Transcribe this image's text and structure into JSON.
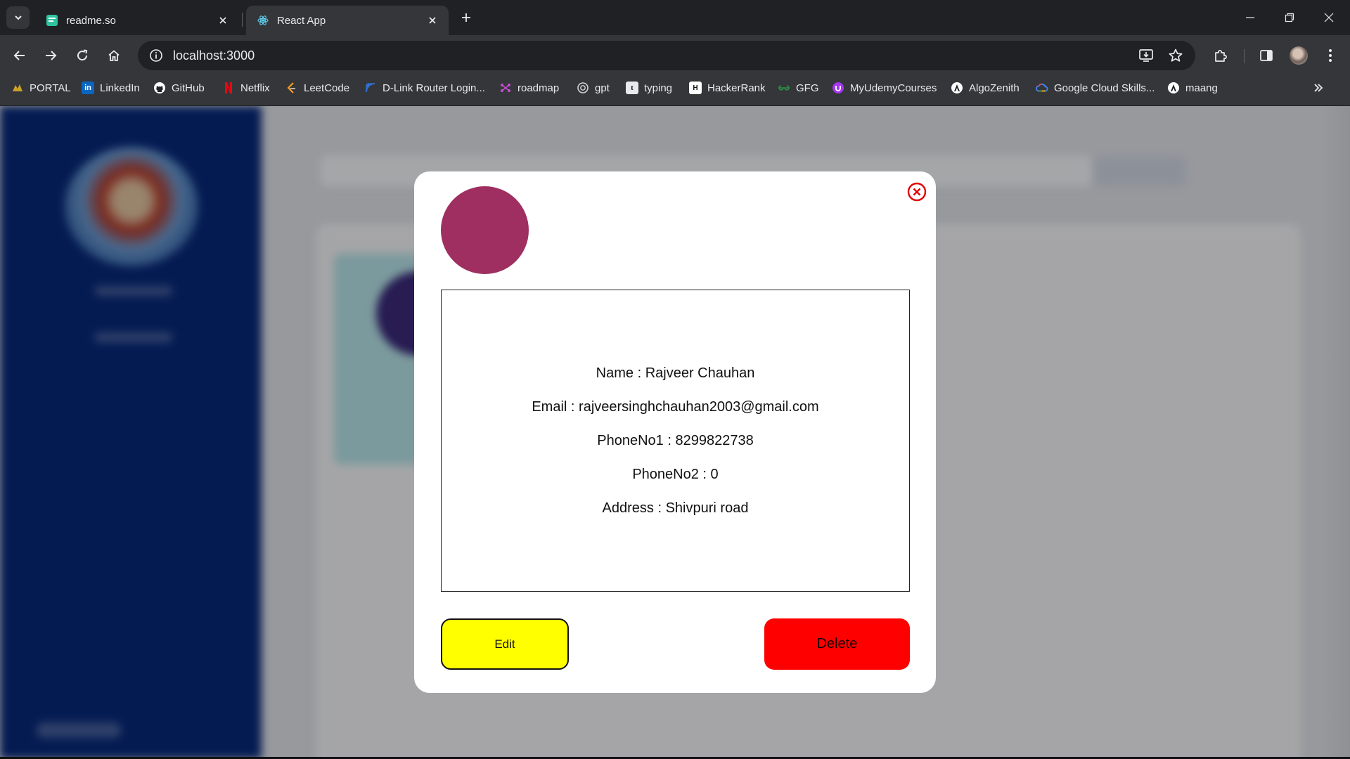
{
  "browser": {
    "tabs": [
      {
        "title": "readme.so",
        "favicon": "readme-icon",
        "active": false
      },
      {
        "title": "React App",
        "favicon": "react-icon",
        "active": true
      }
    ],
    "address": "localhost:3000",
    "bookmarks": [
      {
        "label": "PORTAL",
        "icon": "portal-icon",
        "color": "#c9a227"
      },
      {
        "label": "LinkedIn",
        "icon": "linkedin-icon",
        "color": "#0a66c2"
      },
      {
        "label": "GitHub",
        "icon": "github-icon",
        "color": "#ffffff"
      },
      {
        "label": "Netflix",
        "icon": "netflix-icon",
        "color": "#e50914"
      },
      {
        "label": "LeetCode",
        "icon": "leetcode-icon",
        "color": "#ffa116"
      },
      {
        "label": "D-Link Router Login...",
        "icon": "dlink-icon",
        "color": "#2f6fd0"
      },
      {
        "label": "roadmap",
        "icon": "roadmap-icon",
        "color": "#c74fd6"
      },
      {
        "label": "gpt",
        "icon": "gpt-icon",
        "color": "#cfd2d6"
      },
      {
        "label": "typing",
        "icon": "typing-icon",
        "color": "#e8eaed"
      },
      {
        "label": "HackerRank",
        "icon": "hackerrank-icon",
        "color": "#ffffff"
      },
      {
        "label": "GFG",
        "icon": "gfg-icon",
        "color": "#2f8d46"
      },
      {
        "label": "MyUdemyCourses",
        "icon": "udemy-icon",
        "color": "#a435f0"
      },
      {
        "label": "AlgoZenith",
        "icon": "algozenith-icon",
        "color": "#ffffff"
      },
      {
        "label": "Google Cloud Skills...",
        "icon": "google-cloud-icon",
        "color": "#4285f4"
      },
      {
        "label": "maang",
        "icon": "maang-icon",
        "color": "#ffffff"
      }
    ]
  },
  "modal": {
    "avatar_color": "#9e2f60",
    "details": [
      {
        "label": "Name",
        "value": "Rajveer Chauhan"
      },
      {
        "label": "Email",
        "value": "rajveersinghchauhan2003@gmail.com"
      },
      {
        "label": "PhoneNo1",
        "value": "8299822738"
      },
      {
        "label": "PhoneNo2",
        "value": "0"
      },
      {
        "label": "Address",
        "value": "Shivpuri road"
      }
    ],
    "edit_label": "Edit",
    "delete_label": "Delete",
    "colors": {
      "edit": "#ffff00",
      "delete": "#ff0000",
      "close": "#e00000"
    }
  }
}
